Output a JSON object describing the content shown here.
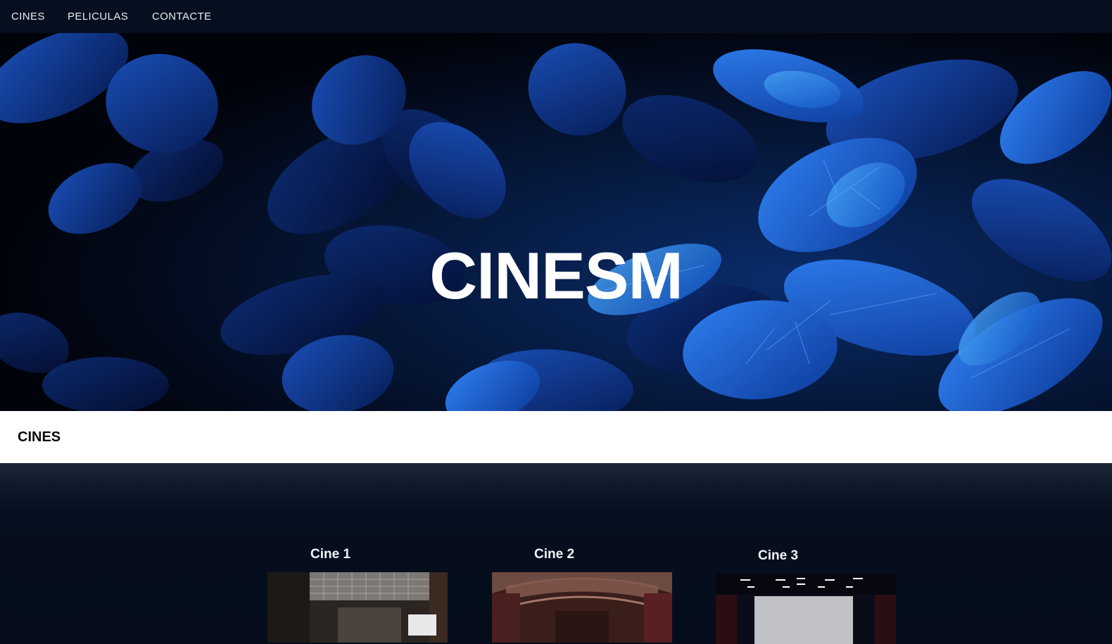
{
  "nav": {
    "items": [
      "CINES",
      "PELICULAS",
      "CONTACTE"
    ]
  },
  "hero": {
    "title": "CINESM"
  },
  "section": {
    "title": "CINES"
  },
  "cinemas": [
    {
      "name": "Cine 1"
    },
    {
      "name": "Cine 2"
    },
    {
      "name": "Cine 3"
    }
  ],
  "colors": {
    "nav_bg": "#060f1f",
    "page_bg": "#050d1c",
    "leaf_blue": "#1f5fd0",
    "text_light": "#ffffff"
  }
}
